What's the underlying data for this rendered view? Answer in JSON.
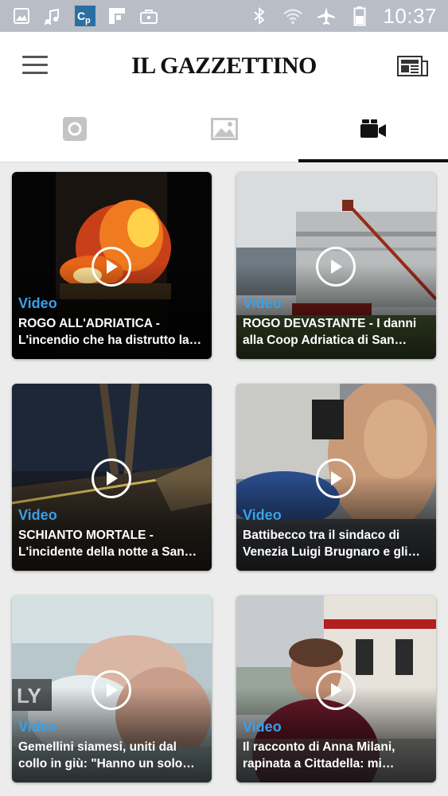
{
  "status_bar": {
    "time": "10:37",
    "left_icons": [
      "gallery-notification-icon",
      "music-notification-icon",
      "cp-app-icon",
      "flipboard-icon",
      "briefcase-icon"
    ],
    "right_icons": [
      "bluetooth-icon",
      "wifi-icon",
      "airplane-mode-icon",
      "battery-icon"
    ]
  },
  "app_bar": {
    "logo": "IL GAZZETTINO",
    "menu_icon": "hamburger-menu-icon",
    "edition_icon": "newspaper-icon"
  },
  "tabs": [
    {
      "name": "photo",
      "icon": "camera-icon",
      "active": false
    },
    {
      "name": "gallery",
      "icon": "image-icon",
      "active": false
    },
    {
      "name": "video",
      "icon": "video-camera-icon",
      "active": true
    }
  ],
  "videos": [
    {
      "badge": "Video",
      "title_line1": "ROGO ALL'ADRIATICA -",
      "title_line2": "L'incendio che ha distrutto la…"
    },
    {
      "badge": "Video",
      "title_line1": "ROGO DEVASTANTE - I danni",
      "title_line2": "alla Coop Adriatica di San…"
    },
    {
      "badge": "Video",
      "title_line1": "SCHIANTO MORTALE -",
      "title_line2": "L'incidente della notte a San…"
    },
    {
      "badge": "Video",
      "title_line1": "Battibecco tra il sindaco di",
      "title_line2": "Venezia Luigi Brugnaro e gli…"
    },
    {
      "badge": "Video",
      "title_line1": "Gemellini siamesi, uniti dal",
      "title_line2": "collo in giù: \"Hanno un solo…"
    },
    {
      "badge": "Video",
      "title_line1": "Il racconto di Anna Milani,",
      "title_line2": "rapinata a Cittadella: mi…"
    }
  ],
  "colors": {
    "status_bar": "#b8bdc6",
    "video_badge": "#3ba0e6",
    "active_tab_indicator": "#111111"
  }
}
